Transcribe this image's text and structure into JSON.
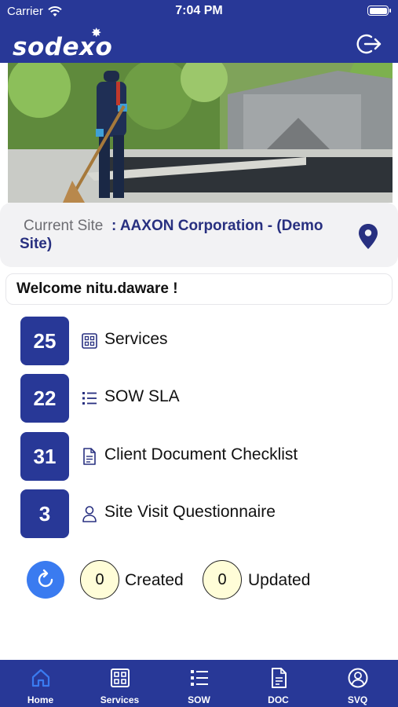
{
  "status_bar": {
    "carrier": "Carrier",
    "time": "7:04 PM"
  },
  "header": {
    "logo_text": "sodexo",
    "logout_icon": "logout-icon",
    "bg_color": "#283897"
  },
  "site": {
    "label": "Current Site",
    "value": ": AAXON  Corporation - (Demo Site)"
  },
  "welcome": {
    "text": "Welcome  nitu.daware  !"
  },
  "menu": [
    {
      "count": "25",
      "label": "Services",
      "icon": "grid-icon"
    },
    {
      "count": "22",
      "label": "SOW SLA",
      "icon": "list-icon"
    },
    {
      "count": "31",
      "label": "Client Document Checklist",
      "icon": "document-icon"
    },
    {
      "count": "3",
      "label": "Site Visit Questionnaire",
      "icon": "person-icon"
    }
  ],
  "sync": {
    "refresh_icon": "refresh-icon",
    "created_count": "0",
    "created_label": "Created",
    "updated_count": "0",
    "updated_label": "Updated"
  },
  "tabs": [
    {
      "label": "Home",
      "icon": "home-icon",
      "active": true
    },
    {
      "label": "Services",
      "icon": "grid-icon"
    },
    {
      "label": "SOW",
      "icon": "list-icon"
    },
    {
      "label": "DOC",
      "icon": "document-icon"
    },
    {
      "label": "SVQ",
      "icon": "person-circle-icon"
    }
  ],
  "colors": {
    "brand": "#283897",
    "refresh": "#3a7bf0",
    "counter_bg": "#fffdd8",
    "tab_active": "#3a7bf0"
  }
}
